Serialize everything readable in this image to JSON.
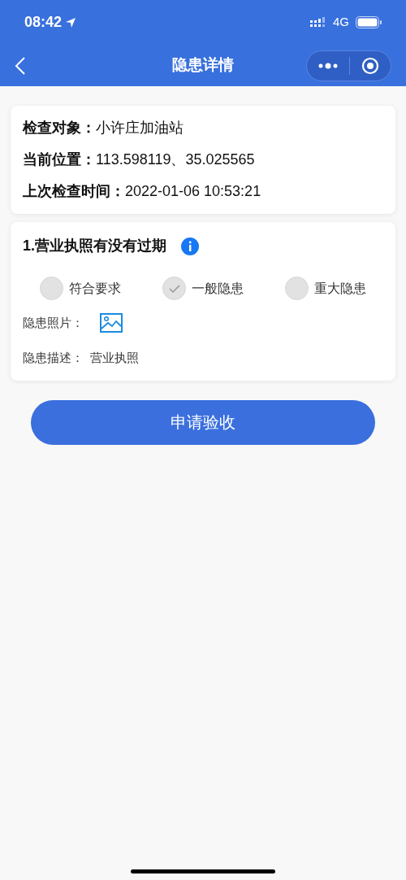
{
  "status_bar": {
    "time": "08:42",
    "network": "4G"
  },
  "nav": {
    "title": "隐患详情"
  },
  "info": [
    {
      "label": "检查对象：",
      "value": "小许庄加油站"
    },
    {
      "label": "当前位置：",
      "value": "113.598119、35.025565"
    },
    {
      "label": "上次检查时间：",
      "value": "2022-01-06 10:53:21"
    }
  ],
  "question": {
    "title": "1.营业执照有没有过期",
    "options": [
      {
        "label": "符合要求",
        "selected": false
      },
      {
        "label": "一般隐患",
        "selected": true
      },
      {
        "label": "重大隐患",
        "selected": false
      }
    ],
    "photo_label": "隐患照片：",
    "description_label": "隐患描述：",
    "description": "营业执照"
  },
  "submit_button": "申请验收"
}
